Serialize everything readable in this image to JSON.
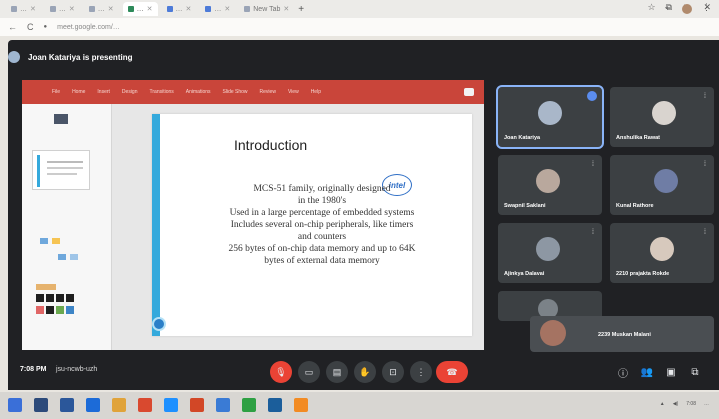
{
  "browser": {
    "tabs": [
      {
        "label": "…",
        "icon": "page-favicon"
      },
      {
        "label": "…",
        "icon": "page-favicon"
      },
      {
        "label": "…",
        "icon": "page-favicon"
      },
      {
        "label": "…",
        "icon": "meet-favicon",
        "active": true
      },
      {
        "label": "…",
        "icon": "doc-favicon"
      },
      {
        "label": "…",
        "icon": "doc-favicon"
      },
      {
        "label": "New Tab",
        "icon": "new-tab-icon"
      }
    ],
    "url": "meet.google.com/…",
    "controls": {
      "minimize": "–",
      "maximize": "□",
      "close": "✕"
    }
  },
  "meet": {
    "presenting_label": "Joan Katariya is presenting",
    "clock": "7:08 PM",
    "meeting_code": "jsu-ncwb-uzh",
    "participants": [
      {
        "name": "Joan Katariya",
        "avatar_color": "#a9b7c9",
        "speaking": true
      },
      {
        "name": "Anshulika Rawat",
        "avatar_color": "#d9d4cf"
      },
      {
        "name": "Swapnil Saklani",
        "avatar_color": "#b9a89d"
      },
      {
        "name": "Kunal Rathore",
        "avatar_color": "#6f7da5"
      },
      {
        "name": "Ajinkya Dalavai",
        "avatar_color": "#8d97a3"
      },
      {
        "name": "2210 prajakta Rokde",
        "avatar_color": "#d7c9bd"
      },
      {
        "name": "",
        "avatar_color": "#7b8288"
      },
      {
        "name": "2239 Muskan Malani",
        "avatar_color": "#a57362"
      }
    ]
  },
  "slide": {
    "title": "Introduction",
    "lines": [
      "MCS-51 family, originally designed",
      "in the 1980's",
      "Used in a large percentage of embedded systems",
      "Includes several on-chip peripherals, like timers",
      "and counters",
      "256 bytes of on-chip data memory and up to 64K",
      "bytes of external data memory"
    ],
    "logo": "intel",
    "ppt_menu": [
      "File",
      "Home",
      "Insert",
      "Design",
      "Transitions",
      "Animations",
      "Slide Show",
      "Review",
      "View",
      "Help"
    ]
  },
  "taskbar": {
    "tray_time": "7:08",
    "tray_date": "…"
  },
  "colors": {
    "meet_bg": "#202124",
    "tile_bg": "#3c4043",
    "ppt_red": "#c9453a",
    "end_call": "#ea4335",
    "slide_accent": "#34a9dc"
  }
}
